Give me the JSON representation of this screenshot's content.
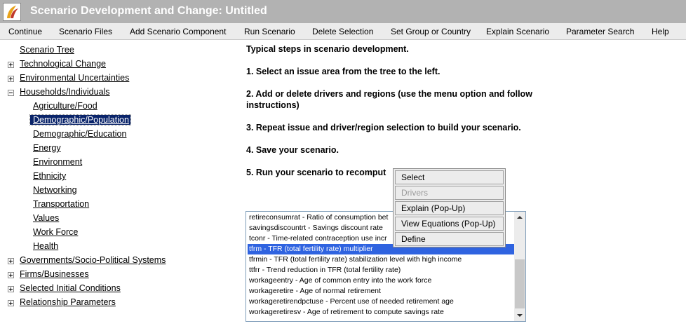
{
  "window": {
    "title": "Scenario Development and Change: Untitled"
  },
  "menubar": {
    "items": [
      "Continue",
      "Scenario Files",
      "Add Scenario Component",
      "Run Scenario",
      "Delete Selection",
      "Set Group or Country",
      "Explain Scenario",
      "Parameter Search",
      "Help"
    ]
  },
  "tree": {
    "root": "Scenario Tree",
    "nodes": [
      "Technological Change",
      "Environmental Uncertainties",
      "Households/Individuals",
      "Agriculture/Food",
      "Demographic/Population",
      "Demographic/Education",
      "Energy",
      "Environment",
      "Ethnicity",
      "Networking",
      "Transportation",
      "Values",
      "Work Force",
      "Health",
      "Governments/Socio-Political Systems",
      "Firms/Businesses",
      "Selected Initial Conditions",
      "Relationship Parameters"
    ]
  },
  "instructions": {
    "heading": "Typical steps in scenario development.",
    "step1": "1. Select an issue area from the tree to the left.",
    "step2": "2. Add or delete drivers and regions (use the menu option and follow instructions)",
    "step3": "3. Repeat issue and driver/region selection to build your scenario.",
    "step4": "4. Save your scenario.",
    "step5": "5. Run your scenario to recomput"
  },
  "parameter_list": {
    "items": [
      "retireconsumrat - Ratio of consumption bet",
      "savingsdiscountrt - Savings discount rate",
      "tconr - Time-related contraception use incr",
      "tfrm - TFR (total fertility rate) multiplier",
      "tfrmin - TFR (total fertility rate) stabilization level with high income",
      "ttfrr - Trend reduction in TFR (total fertility rate)",
      "workageentry - Age of common entry into the work force",
      "workageretire - Age of normal retirement",
      "workageretirendpctuse - Percent use of needed retirement age",
      "workageretiresv - Age of retirement to compute savings rate"
    ],
    "selected": "tfrm - TFR (total fertility rate) multiplier"
  },
  "context_menu": {
    "items": [
      "Select",
      "Drivers",
      "Explain (Pop-Up)",
      "View Equations (Pop-Up)",
      "Define"
    ],
    "disabled": "Drivers"
  },
  "colors": {
    "titlebar": "#b2b2b2",
    "selection": "#0a246a",
    "list_selection": "#2f63e0",
    "logo_orange": "#e8a21a"
  }
}
